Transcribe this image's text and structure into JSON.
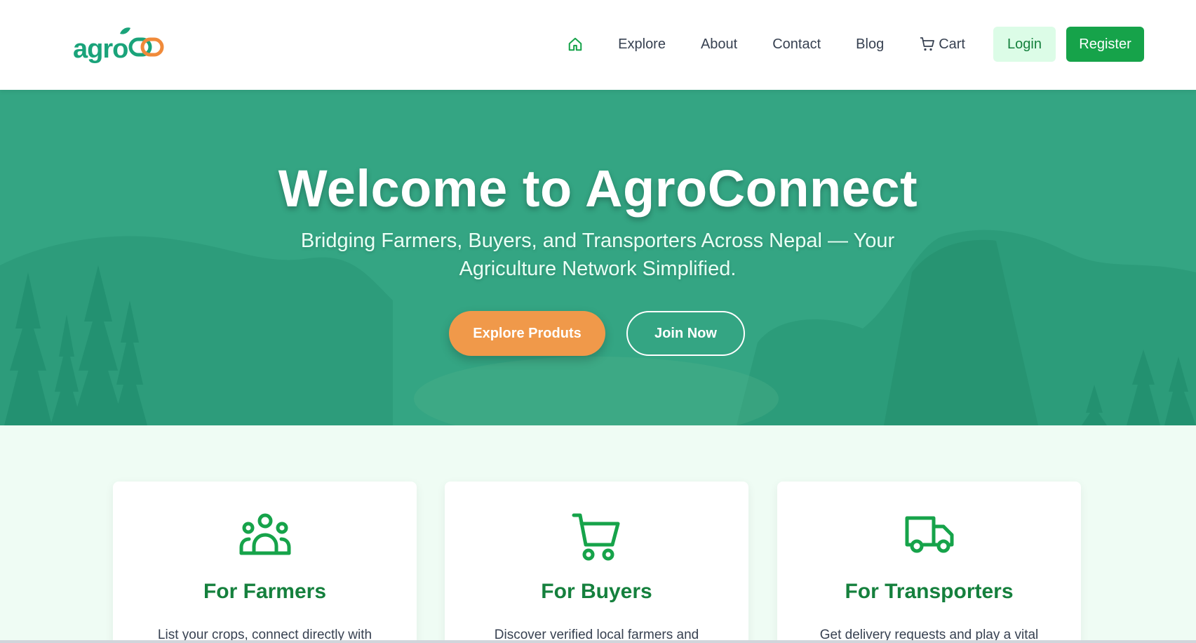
{
  "brand": {
    "logo_text": "agro"
  },
  "nav": {
    "items": [
      {
        "label": "Explore"
      },
      {
        "label": "About"
      },
      {
        "label": "Contact"
      },
      {
        "label": "Blog"
      },
      {
        "label": "Cart"
      }
    ],
    "login_label": "Login",
    "register_label": "Register"
  },
  "hero": {
    "title": "Welcome to AgroConnect",
    "subtitle": "Bridging Farmers, Buyers, and Transporters Across Nepal — Your Agriculture Network Simplified.",
    "primary_cta": "Explore Produts",
    "secondary_cta": "Join Now"
  },
  "features": [
    {
      "icon": "users-icon",
      "title": "For Farmers",
      "text": "List your crops, connect directly with"
    },
    {
      "icon": "cart-icon",
      "title": "For Buyers",
      "text": "Discover verified local farmers and"
    },
    {
      "icon": "truck-icon",
      "title": "For Transporters",
      "text": "Get delivery requests and play a vital"
    }
  ],
  "colors": {
    "brand_green": "#16a34a",
    "hero_green": "#34a583",
    "accent_orange": "#f0994a",
    "logo_orange": "#f08a3a",
    "title_green": "#15803d"
  }
}
